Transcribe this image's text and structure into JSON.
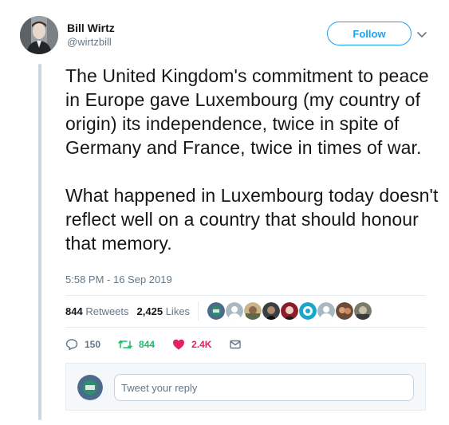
{
  "author": {
    "display_name": "Bill Wirtz",
    "handle": "@wirtzbill"
  },
  "follow_label": "Follow",
  "tweet": {
    "paragraphs": [
      "The United Kingdom's commitment to peace in Europe gave Luxembourg (my country of origin) its independence, twice in spite of Germany and France, twice in times of war.",
      "What happened in Luxembourg today doesn't reflect well on a country that should honour that memory."
    ],
    "timestamp": "5:58 PM - 16 Sep 2019"
  },
  "stats": {
    "retweets_count": "844",
    "retweets_label": "Retweets",
    "likes_count": "2,425",
    "likes_label": "Likes"
  },
  "actions": {
    "reply_count": "150",
    "retweet_count": "844",
    "like_count": "2.4K"
  },
  "reply": {
    "placeholder": "Tweet your reply"
  },
  "colors": {
    "brand": "#1da1f2",
    "retweet": "#17bf63",
    "like": "#e0245e",
    "muted": "#657786"
  },
  "icons": [
    "chevron-down-icon",
    "reply-icon",
    "retweet-icon",
    "heart-icon",
    "message-icon"
  ]
}
